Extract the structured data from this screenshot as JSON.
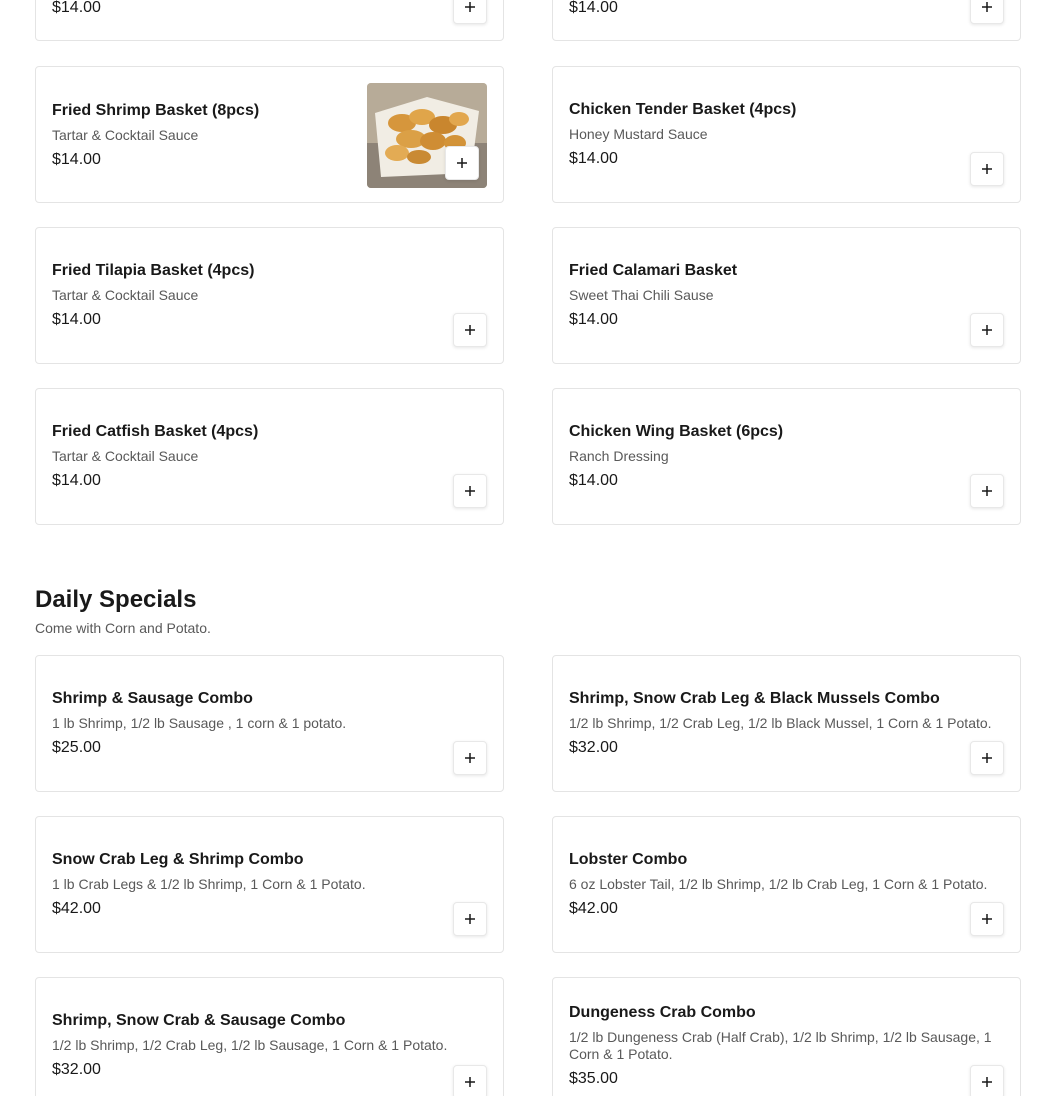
{
  "top_partial": [
    {
      "price": "$14.00"
    },
    {
      "price": "$14.00"
    }
  ],
  "baskets": [
    {
      "title": "Fried Shrimp Basket (8pcs)",
      "desc": "Tartar & Cocktail Sauce",
      "price": "$14.00"
    },
    {
      "title": "Chicken Tender Basket (4pcs)",
      "desc": "Honey Mustard Sauce",
      "price": "$14.00"
    },
    {
      "title": "Fried Tilapia Basket (4pcs)",
      "desc": "Tartar & Cocktail Sauce",
      "price": "$14.00"
    },
    {
      "title": "Fried Calamari Basket",
      "desc": "Sweet Thai Chili Sause",
      "price": "$14.00"
    },
    {
      "title": "Fried Catfish Basket (4pcs)",
      "desc": "Tartar & Cocktail Sauce",
      "price": "$14.00"
    },
    {
      "title": "Chicken Wing Basket (6pcs)",
      "desc": "Ranch Dressing",
      "price": "$14.00"
    }
  ],
  "daily_specials": {
    "title": "Daily Specials",
    "subtitle": "Come with Corn and Potato.",
    "items": [
      {
        "title": "Shrimp & Sausage Combo",
        "desc": "1 lb Shrimp, 1/2 lb Sausage , 1 corn & 1 potato.",
        "price": "$25.00"
      },
      {
        "title": "Shrimp, Snow Crab Leg & Black Mussels Combo",
        "desc": "1/2 lb Shrimp, 1/2 Crab Leg, 1/2 lb Black Mussel, 1 Corn & 1 Potato.",
        "price": "$32.00"
      },
      {
        "title": "Snow Crab Leg & Shrimp Combo",
        "desc": "1 lb Crab Legs & 1/2 lb Shrimp, 1 Corn & 1 Potato.",
        "price": "$42.00"
      },
      {
        "title": "Lobster Combo",
        "desc": "6 oz Lobster Tail, 1/2 lb Shrimp, 1/2 lb Crab Leg, 1 Corn & 1 Potato.",
        "price": "$42.00"
      },
      {
        "title": "Shrimp, Snow Crab & Sausage Combo",
        "desc": "1/2 lb Shrimp, 1/2 Crab Leg, 1/2 lb Sausage, 1 Corn & 1 Potato.",
        "price": "$32.00"
      },
      {
        "title": "Dungeness Crab Combo",
        "desc": "1/2 lb Dungeness Crab (Half Crab), 1/2 lb Shrimp, 1/2 lb Sausage, 1 Corn & 1 Potato.",
        "price": "$35.00"
      }
    ]
  },
  "icons": {
    "add": "plus-icon",
    "food_photo": "fried-shrimp-photo"
  }
}
